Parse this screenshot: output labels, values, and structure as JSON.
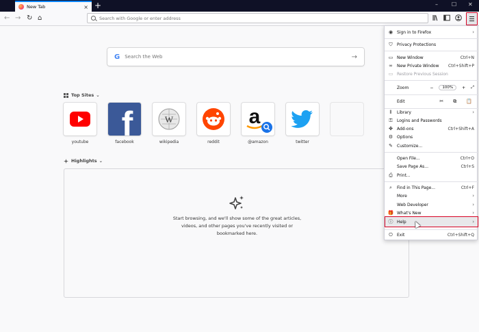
{
  "tab": {
    "title": "New Tab",
    "close": "×"
  },
  "newtab": "+",
  "window": {
    "minimize": "–",
    "maximize": "☐",
    "close": "✕"
  },
  "nav": {
    "back": "←",
    "forward": "→",
    "reload": "↻",
    "home": "⌂"
  },
  "urlbar": {
    "placeholder": "Search with Google or enter address"
  },
  "search": {
    "placeholder": "Search the Web",
    "arrow": "→",
    "g": "G"
  },
  "top_sites": {
    "header": "Top Sites",
    "chevron": "⌄",
    "sites": [
      {
        "label": "youtube"
      },
      {
        "label": "facebook"
      },
      {
        "label": "wikipedia"
      },
      {
        "label": "reddit"
      },
      {
        "label": "@amazon"
      },
      {
        "label": "twitter"
      }
    ]
  },
  "highlights": {
    "header": "Highlights",
    "chevron": "⌄",
    "line1": "Start browsing, and we'll show some of the great articles,",
    "line2": "videos, and other pages you've recently visited or",
    "line3": "bookmarked here."
  },
  "menu": {
    "sign_in": "Sign in to Firefox",
    "privacy": "Privacy Protections",
    "new_window": "New Window",
    "new_window_sc": "Ctrl+N",
    "new_private": "New Private Window",
    "new_private_sc": "Ctrl+Shift+P",
    "restore": "Restore Previous Session",
    "zoom": "Zoom",
    "zoom_minus": "−",
    "zoom_pct": "100%",
    "zoom_plus": "+",
    "zoom_full": "⤢",
    "edit": "Edit",
    "library": "Library",
    "logins": "Logins and Passwords",
    "addons": "Add-ons",
    "addons_sc": "Ctrl+Shift+A",
    "options": "Options",
    "customize": "Customize...",
    "open_file": "Open File...",
    "open_file_sc": "Ctrl+O",
    "save_page": "Save Page As...",
    "save_page_sc": "Ctrl+S",
    "print": "Print...",
    "find": "Find in This Page...",
    "find_sc": "Ctrl+F",
    "more": "More",
    "web_dev": "Web Developer",
    "whats_new": "What's New",
    "help": "Help",
    "exit": "Exit",
    "exit_sc": "Ctrl+Shift+Q",
    "chevron": "›"
  },
  "colors": {
    "accent": "#0a84ff",
    "highlight_border": "#d70022",
    "titlebar": "#0f1126"
  }
}
